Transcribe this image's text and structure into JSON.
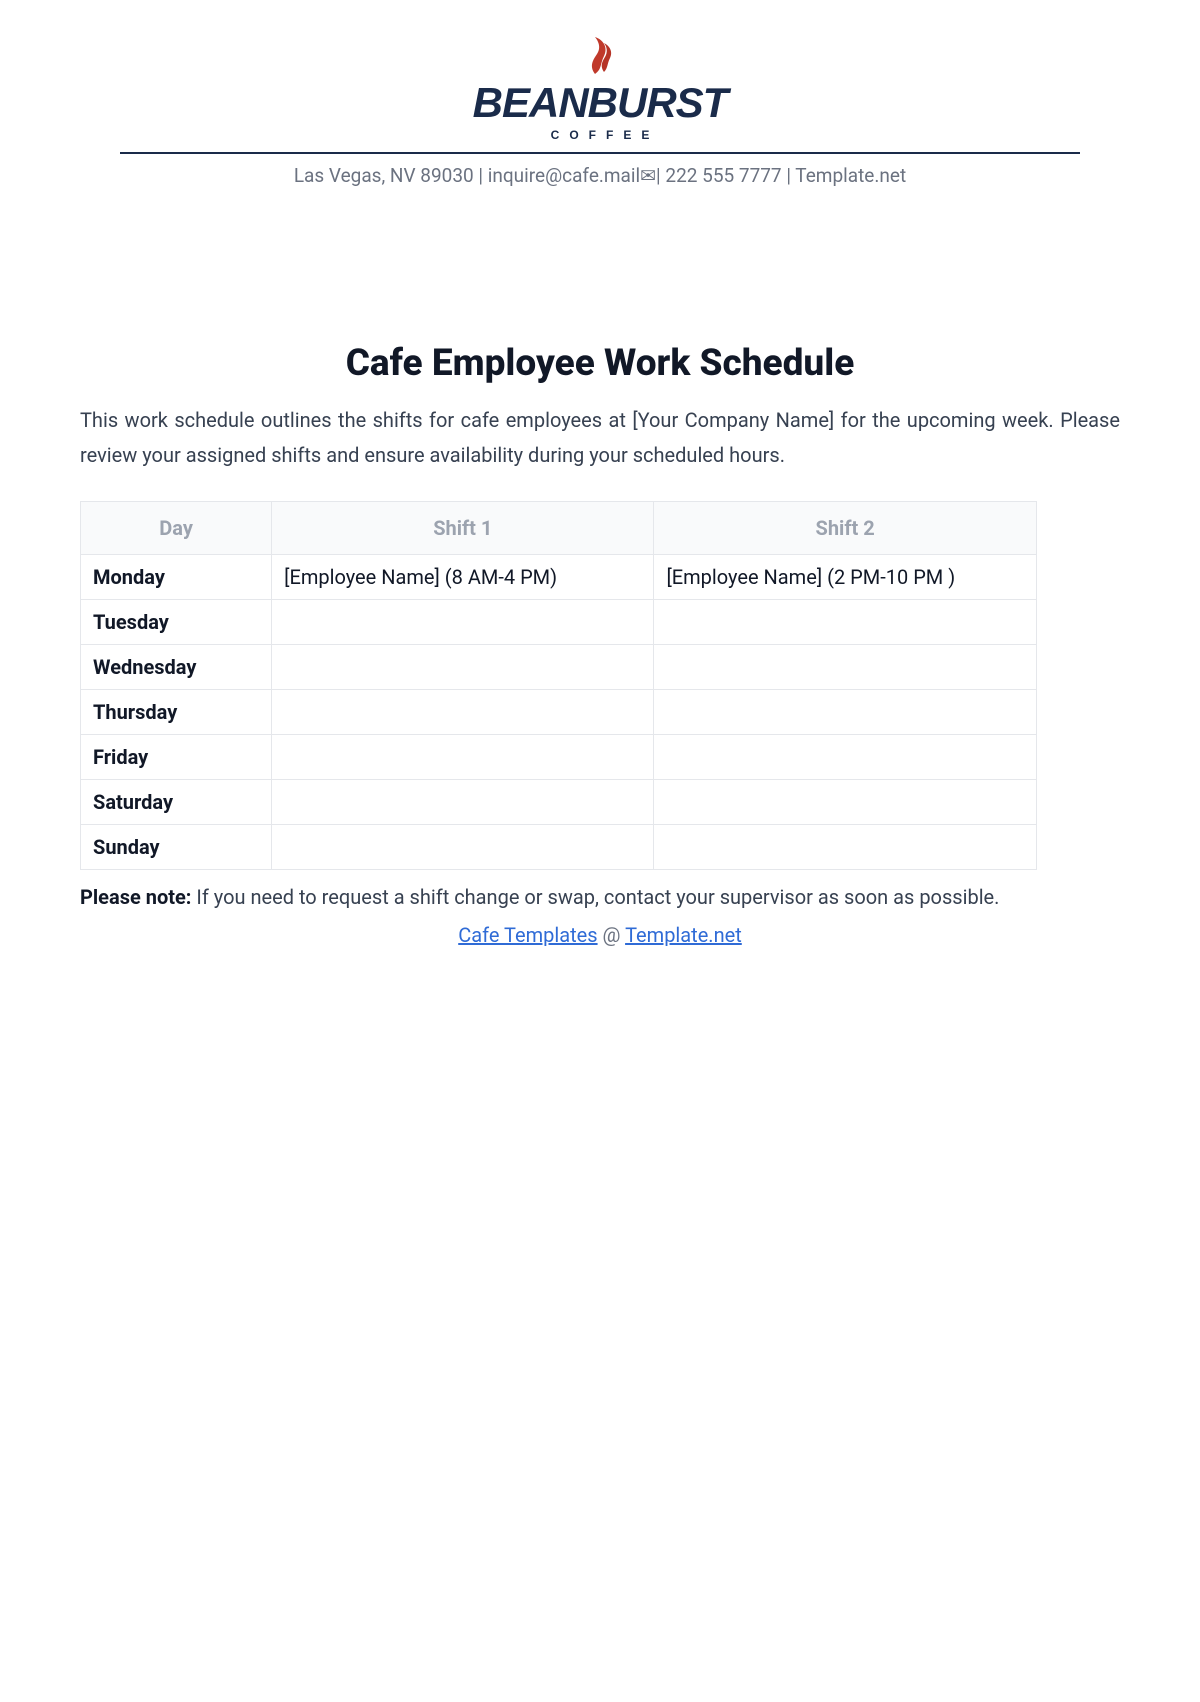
{
  "logo": {
    "word": "BEANBURST",
    "sub": "COFFEE"
  },
  "contact_line": "Las Vegas, NV 89030 | inquire@cafe.mail✉| 222 555 7777 | Template.net",
  "title": "Cafe Employee Work Schedule",
  "intro": "This work schedule outlines the shifts for cafe employees at [Your Company Name] for the upcoming week. Please review your assigned shifts and ensure availability during your scheduled hours.",
  "table": {
    "headers": {
      "day": "Day",
      "shift1": "Shift 1",
      "shift2": "Shift 2"
    },
    "rows": [
      {
        "day": "Monday",
        "shift1": "[Employee Name] (8 AM-4 PM)",
        "shift2": "[Employee Name] (2 PM-10 PM )"
      },
      {
        "day": "Tuesday",
        "shift1": "",
        "shift2": ""
      },
      {
        "day": "Wednesday",
        "shift1": "",
        "shift2": ""
      },
      {
        "day": "Thursday",
        "shift1": "",
        "shift2": ""
      },
      {
        "day": "Friday",
        "shift1": "",
        "shift2": ""
      },
      {
        "day": "Saturday",
        "shift1": "",
        "shift2": ""
      },
      {
        "day": "Sunday",
        "shift1": "",
        "shift2": ""
      }
    ]
  },
  "note_label": "Please note:",
  "note_text": " If you need to request a shift change or swap, contact your supervisor as soon as possible.",
  "footer": {
    "link1": "Cafe Templates",
    "at": " @ ",
    "link2": "Template.net"
  }
}
